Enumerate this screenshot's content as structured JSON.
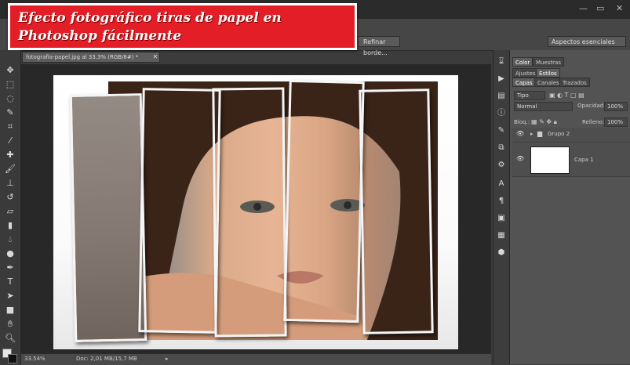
{
  "banner": {
    "line1": "Efecto fotográfico tiras de papel en",
    "line2": "Photoshop fácilmente"
  },
  "options_bar": {
    "refine_button": "Refinar borde...",
    "workspace_select": "Aspectos esenciales"
  },
  "document": {
    "tab_title": "fotografia-papel.jpg al 33.3% (RGB/8#) *",
    "status_zoom": "33.54%",
    "status_doc": "Doc: 2,01 MB/15,7 MB"
  },
  "panels": {
    "top_tabs": [
      "Color",
      "Muestras"
    ],
    "second_tabs": [
      "Ajustes",
      "Estilos"
    ],
    "layers_tabs": [
      "Capas",
      "Canales",
      "Trazados"
    ],
    "kind_filter": "Tipo",
    "blend_mode": "Normal",
    "opacity_label": "Opacidad:",
    "opacity_value": "100%",
    "lock_label": "Bloq.:",
    "fill_label": "Relleno:",
    "fill_value": "100%",
    "layers": [
      {
        "name": "Grupo 2",
        "type": "group"
      },
      {
        "name": "Capa 1",
        "type": "layer"
      }
    ]
  },
  "colors": {
    "banner_bg": "#e41e26",
    "workspace_bg": "#282828",
    "panel_bg": "#535353"
  }
}
